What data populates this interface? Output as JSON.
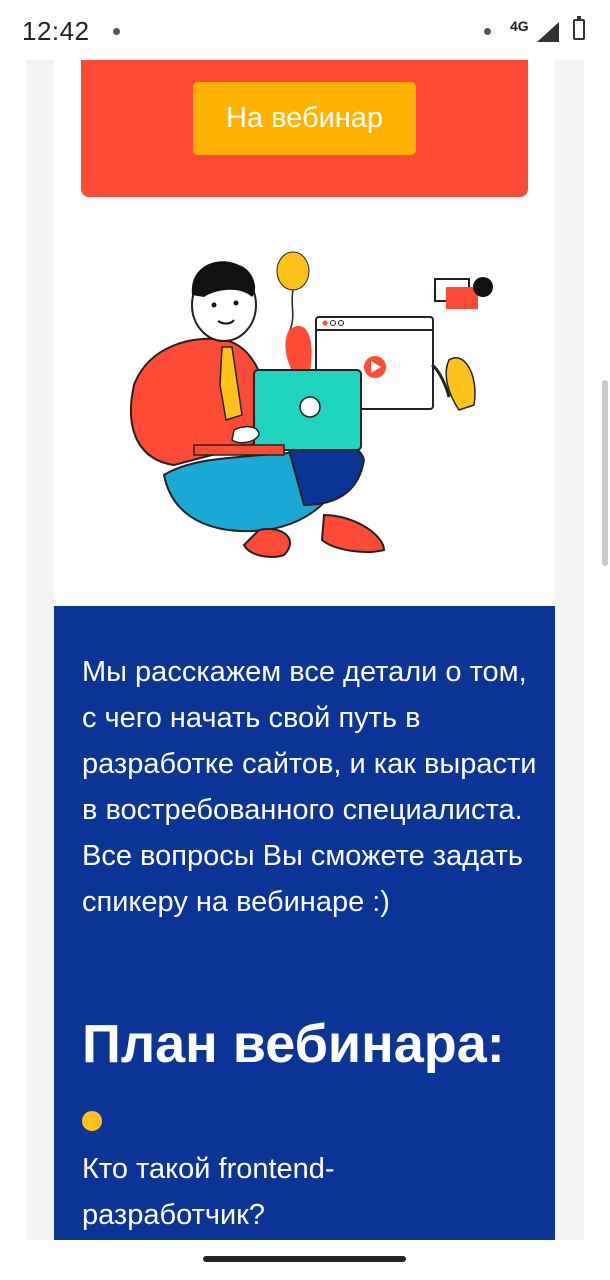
{
  "statusbar": {
    "time": "12:42",
    "network": "4G",
    "icons": [
      "signal-icon",
      "battery-icon"
    ]
  },
  "banner": {
    "cta_label": "На вебинар",
    "colors": {
      "banner": "#ff4b35",
      "button": "#ffb300"
    }
  },
  "illustration": {
    "description_icon": "developer-with-laptop-illustration"
  },
  "info": {
    "text": "Мы расскажем все детали о том, с чего начать свой путь в разработке сайтов, и как вырасти в востребованного специалиста. Все вопросы Вы сможете задать спикеру на вебинаре :)",
    "plan_title": "План вебинара:",
    "plan_items": [
      "Кто такой frontend-разработчик?"
    ],
    "colors": {
      "background": "#0b3497",
      "bullet": "#ffc21b"
    }
  }
}
